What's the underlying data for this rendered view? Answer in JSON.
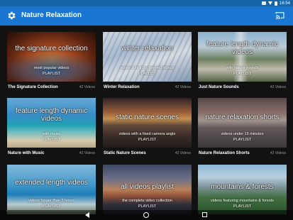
{
  "status": {
    "time": "16:54"
  },
  "app": {
    "title": "Nature Relaxation"
  },
  "cards": [
    {
      "thumb_title": "the signature collection",
      "thumb_sub": "most popular videos",
      "badge": "PLAYLIST",
      "title": "The Signature Collection",
      "count": "42 Videos"
    },
    {
      "thumb_title": "winter relaxation",
      "thumb_sub": "winter & holiday themed videos",
      "badge": "PLAYLIST",
      "title": "Winter Relaxation",
      "count": "42 Videos"
    },
    {
      "thumb_title": "feature length dynamic videos",
      "thumb_sub": "with nature sounds",
      "badge": "PLAYLIST",
      "title": "Just Nature Sounds",
      "count": "42 Videos"
    },
    {
      "thumb_title": "feature length dynamic videos",
      "thumb_sub": "with music",
      "badge": "PLAYLIST",
      "title": "Nature with Music",
      "count": "42 Videos"
    },
    {
      "thumb_title": "static nature scenes",
      "thumb_sub": "videos with a fixed camera angle",
      "badge": "PLAYLIST",
      "title": "Static Nature Scenes",
      "count": "42 Videos"
    },
    {
      "thumb_title": "nature relaxation shorts",
      "thumb_sub": "videos under 15 minutes",
      "badge": "PLAYLIST",
      "title": "Nature Relaxation Shorts",
      "count": "42 Videos"
    },
    {
      "thumb_title": "extended length videos",
      "thumb_sub": "videos longer than 3 hours",
      "badge": "PLAYLIST",
      "title": "",
      "count": ""
    },
    {
      "thumb_title": "all videos playlist",
      "thumb_sub": "the complete video collection",
      "badge": "PLAYLIST",
      "title": "",
      "count": ""
    },
    {
      "thumb_title": "mountains & forests",
      "thumb_sub": "videos featuring mountains & forests",
      "badge": "PLAYLIST",
      "title": "",
      "count": ""
    }
  ],
  "icons": {
    "settings": "gear-icon",
    "cast": "cast-icon",
    "back": "back-icon",
    "home": "home-icon",
    "recents": "recents-icon"
  },
  "colors": {
    "status_bar": "#1565a8",
    "app_bar": "#1976d2",
    "background": "#121212",
    "count_text": "#9a9a9a"
  }
}
